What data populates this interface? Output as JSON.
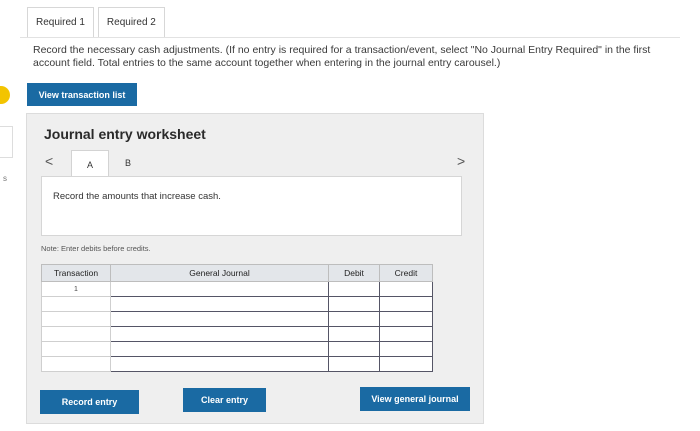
{
  "tabs": [
    {
      "label": "Required 1"
    },
    {
      "label": "Required 2"
    }
  ],
  "instructions": "Record the necessary cash adjustments. (If no entry is required for a transaction/event, select \"No Journal Entry Required\" in the first account field. Total entries to the same account together when entering in the journal entry carousel.)",
  "view_transaction_label": "View transaction list",
  "edge_text": "s",
  "worksheet": {
    "title": "Journal entry worksheet",
    "prev_glyph": "<",
    "next_glyph": ">",
    "tabs": [
      "A",
      "B"
    ],
    "description": "Record the amounts that increase cash.",
    "note": "Note: Enter debits before credits.",
    "columns": [
      "Transaction",
      "General Journal",
      "Debit",
      "Credit"
    ],
    "rows": [
      {
        "transaction": "1"
      },
      {
        "transaction": ""
      },
      {
        "transaction": ""
      },
      {
        "transaction": ""
      },
      {
        "transaction": ""
      },
      {
        "transaction": ""
      }
    ]
  },
  "buttons": {
    "record": "Record entry",
    "clear": "Clear entry",
    "view_journal": "View general journal"
  },
  "colors": {
    "button": "#1a6aa3",
    "marker": "#f3c400",
    "panel": "#efefef"
  }
}
